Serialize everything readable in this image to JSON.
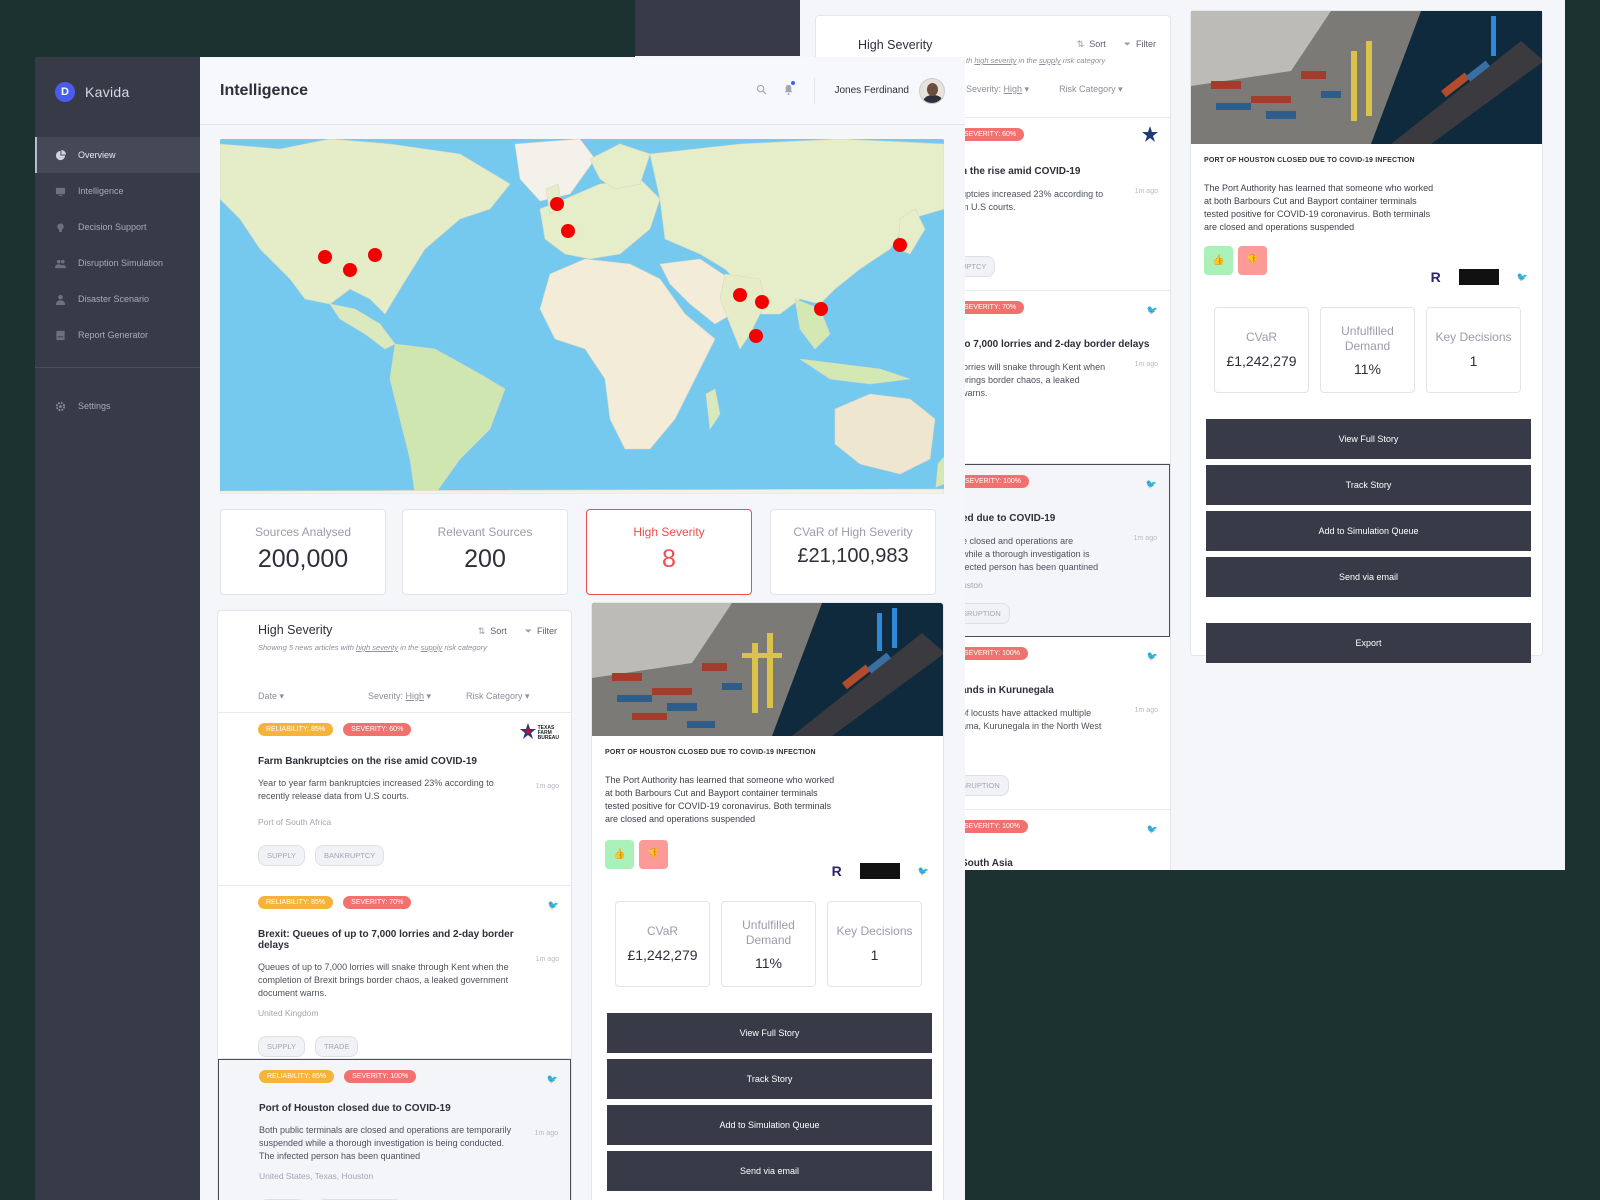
{
  "app": {
    "brand": "Kavida",
    "brand_initial": "D",
    "page_title": "Intelligence",
    "user_name": "Jones Ferdinand"
  },
  "sidebar": {
    "items": [
      {
        "label": "Overview",
        "icon": "pie-chart-icon",
        "active": true
      },
      {
        "label": "Intelligence",
        "icon": "tv-icon"
      },
      {
        "label": "Decision Support",
        "icon": "lightbulb-icon"
      },
      {
        "label": "Disruption Simulation",
        "icon": "users-icon"
      },
      {
        "label": "Disaster Scenario",
        "icon": "person-icon"
      },
      {
        "label": "Report Generator",
        "icon": "report-icon"
      }
    ],
    "settings": "Settings"
  },
  "stats": [
    {
      "label": "Sources Analysed",
      "value": "200,000"
    },
    {
      "label": "Relevant Sources",
      "value": "200"
    },
    {
      "label": "High Severity",
      "value": "8",
      "highlight": true
    },
    {
      "label": "CVaR of High Severity",
      "value": "£21,100,983"
    }
  ],
  "feed": {
    "title": "High Severity",
    "sort": "Sort",
    "filter": "Filter",
    "subtitle_prefix": "Showing 5 news articles with ",
    "subtitle_severity": "high severity",
    "subtitle_mid": " in the ",
    "subtitle_category": "supply",
    "subtitle_suffix": " risk category",
    "col_date": "Date",
    "col_severity": "Severity: ",
    "col_severity_value": "High",
    "col_risk": "Risk Category",
    "articles": [
      {
        "reliability": "RELIABILITY: 85%",
        "severity": "SEVERITY: 60%",
        "title": "Farm Bankruptcies on the rise amid COVID-19",
        "body": "Year to year farm bankruptcies increased 23% according to recently release data from U.S courts.",
        "time": "1m ago",
        "location": "Port of South Africa",
        "tags": [
          "SUPPLY",
          "BANKRUPTCY"
        ],
        "source": "texas-farm-bureau-logo"
      },
      {
        "reliability": "RELIABILITY: 85%",
        "severity": "SEVERITY: 70%",
        "title": "Brexit: Queues of up to 7,000 lorries and 2-day border delays",
        "body": "Queues of up to 7,000 lorries will snake through Kent when the completion of Brexit brings border chaos, a leaked government document warns.",
        "time": "1m ago",
        "location": "United Kingdom",
        "tags": [
          "SUPPLY",
          "TRADE"
        ],
        "source": "twitter-icon"
      },
      {
        "reliability": "RELIABILITY: 85%",
        "severity": "SEVERITY: 100%",
        "title": "Port of Houston closed due to COVID-19",
        "body": "Both public terminals are closed and operations are temporarily suspended while a thorough investigation is being conducted. The infected person has been quantined",
        "time": "1m ago",
        "location": "United States, Texas, Houston",
        "tags": [
          "SUPPLY",
          "PORT DISRUPTION"
        ],
        "source": "twitter-icon"
      }
    ],
    "texas_logo_text": [
      "TEXAS",
      "FARM",
      "BUREAU"
    ]
  },
  "detail": {
    "headline": "PORT OF HOUSTON CLOSED DUE TO COVID-19 INFECTION",
    "body": "The Port Authority has learned that someone who worked at both Barbours Cut and Bayport container terminals tested positive for COVID-19 coronavirus. Both terminals are closed and operations suspended",
    "metrics": [
      {
        "label": "CVaR",
        "value": "£1,242,279"
      },
      {
        "label": "Unfulfilled Demand",
        "value": "11%"
      },
      {
        "label": "Key Decisions",
        "value": "1"
      }
    ],
    "buttons": [
      "View Full Story",
      "Track Story",
      "Add to Simulation Queue",
      "Send via email"
    ]
  },
  "back": {
    "feed_title": "High Severity",
    "sort": "Sort",
    "filter": "Filter",
    "subtitle_tail_1": "th ",
    "subtitle_severity": "high severity",
    "subtitle_mid": " in the ",
    "subtitle_category": "supply",
    "subtitle_suffix": " risk category",
    "col_severity": "Severity: ",
    "col_severity_value": "High",
    "col_risk": "Risk Category",
    "items": [
      {
        "sev": "SEVERITY: 60%",
        "title": "n the rise amid COVID-19",
        "body": "uptcies increased 23% according to\nm U.S courts.",
        "time": "1m ago",
        "tag": "UPTCY"
      },
      {
        "sev": "SEVERITY: 70%",
        "title": "to 7,000 lorries and 2-day border delays",
        "body": "lorries will snake through Kent when\nbrings border chaos, a leaked\nwarns.",
        "time": "1m ago",
        "tag": ""
      },
      {
        "sev": "SEVERITY: 100%",
        "title": "ed due to COVID-19",
        "body": "e closed and operations are\nwhile a thorough investigation is\nfected person has been quantined",
        "loc": "uston",
        "time": "1m ago",
        "tag": "SRUPTION"
      },
      {
        "sev": "SEVERITY: 100%",
        "title": "ands in Kurunegala",
        "body": "of locusts have attacked multiple\nama, Kurunegala in the North West",
        "time": "1m ago",
        "tag": "SRUPTION"
      },
      {
        "sev": "SEVERITY: 100%",
        "title": "South Asia",
        "body": "",
        "time": "",
        "tag": ""
      }
    ],
    "detail_headline": "PORT OF HOUSTON CLOSED DUE TO COVID-19 INFECTION",
    "detail_body": "The Port Authority has learned that someone who worked at both Barbours Cut and Bayport container terminals tested positive for COVID-19 coronavirus. Both terminals are closed and operations suspended",
    "metrics": [
      {
        "label": "CVaR",
        "value": "£1,242,279"
      },
      {
        "label": "Unfulfilled Demand",
        "value": "11%"
      },
      {
        "label": "Key Decisions",
        "value": "1"
      }
    ],
    "buttons": [
      "View Full Story",
      "Track Story",
      "Add to Simulation Queue",
      "Send via email",
      "Export"
    ]
  },
  "colors": {
    "sidebar": "#383a47",
    "accent": "#4a5cf0",
    "danger": "#ee4d4d",
    "reliability": "#f6b33a",
    "severity": "#f2716e",
    "ocean": "#76c9ee",
    "land": "#f2ecd9",
    "marker": "#f40000"
  }
}
